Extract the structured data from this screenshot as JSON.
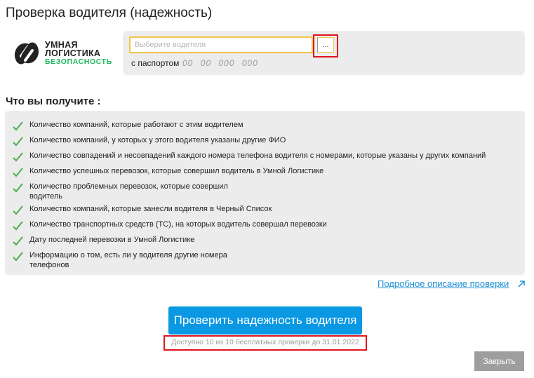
{
  "dialog": {
    "title": "Проверка водителя (надежность)"
  },
  "logo": {
    "line1": "УМНАЯ",
    "line2": "ЛОГИСТИКА",
    "line3": "БЕЗОПАСНОСТЬ",
    "brand_color": "#1bb85a"
  },
  "driver": {
    "placeholder": "Выберите водителя",
    "picker_label": "...",
    "passport_label": "с паспортом",
    "passport_mask": "00 00 000 000"
  },
  "features": {
    "title": "Что вы получите :",
    "items": [
      "Количество компаний, которые работают с этим водителем",
      "Количество компаний, у которых у этого водителя указаны другие ФИО",
      "Количество совпадений и несовпадений каждого номера телефона водителя с номерами, которые указаны у других компаний",
      "Количество успешных перевозок, которые совершил водитель в Умной Логистике",
      "Количество проблемных перевозок, которые совершил водитель",
      "Количество компаний, которые занесли водителя в Черный Список",
      "Количество транспортных средств (ТС), на которых водитель совершал перевозки",
      "Дату последней перевозки в Умной Логистике",
      "Информацию о том, есть ли у водителя другие номера телефонов"
    ],
    "check_icon": "check-icon",
    "check_color": "#4caf50"
  },
  "details_link": "Подробное описание проверки",
  "actions": {
    "check_label": "Проверить надежность водителя",
    "availability": "Доступно 10 из 10 бесплатных проверки до 31.01.2022",
    "close_label": "Закрыть"
  },
  "colors": {
    "accent": "#0b98e3",
    "highlight": "#e0141e",
    "input_border": "#f0c64a"
  }
}
